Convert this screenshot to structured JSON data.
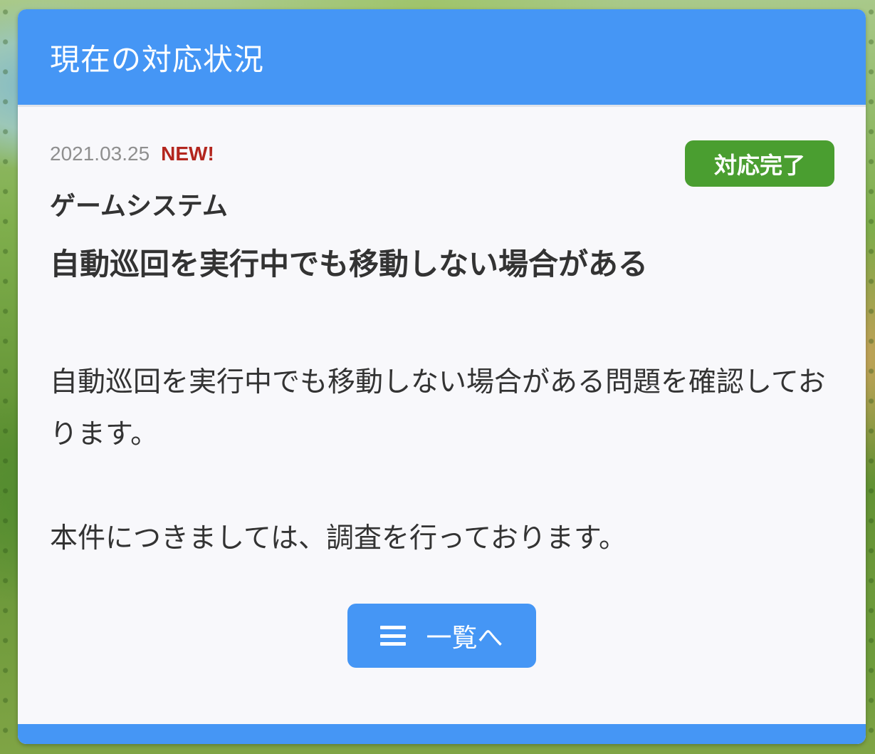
{
  "header": {
    "title": "現在の対応状況"
  },
  "article": {
    "date": "2021.03.25",
    "new_label": "NEW!",
    "status": "対応完了",
    "category": "ゲームシステム",
    "title": "自動巡回を実行中でも移動しない場合がある",
    "paragraphs": [
      "自動巡回を実行中でも移動しない場合がある問題を確認しております。",
      "本件につきましては、調査を行っております。"
    ]
  },
  "actions": {
    "list_label": "一覧へ",
    "list_icon": "menu-icon"
  },
  "colors": {
    "accent": "#4596f5",
    "status_complete": "#4a9e30",
    "new_label": "#b3261e",
    "card_bg": "#f8f8fb"
  }
}
